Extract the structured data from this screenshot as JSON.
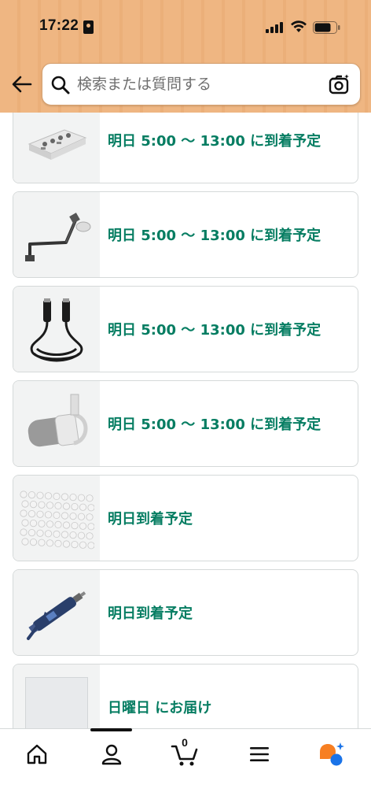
{
  "status_bar": {
    "time": "17:22"
  },
  "search": {
    "placeholder": "検索または質問する"
  },
  "orders": [
    {
      "delivery_text": "明日 5:00 〜 13:00 に到着予定",
      "item": "audio-mixer-image"
    },
    {
      "delivery_text": "明日 5:00 〜 13:00 に到着予定",
      "item": "mic-boom-arm-image"
    },
    {
      "delivery_text": "明日 5:00 〜 13:00 に到着予定",
      "item": "xlr-cable-image"
    },
    {
      "delivery_text": "明日 5:00 〜 13:00 に到着予定",
      "item": "microphone-image"
    },
    {
      "delivery_text": "明日到着予定",
      "item": "round-pads-image"
    },
    {
      "delivery_text": "明日到着予定",
      "item": "thermal-paste-image"
    },
    {
      "delivery_text": "日曜日 にお届け",
      "item": "white-panel-image"
    }
  ],
  "bottom_nav": {
    "items": [
      "home-icon",
      "account-icon",
      "cart-icon",
      "menu-icon",
      "assistant-icon"
    ],
    "cart_count": "0"
  },
  "colors": {
    "header": "#efb682",
    "delivery_green": "#067d62",
    "assistant_orange": "#f77f22",
    "assistant_blue": "#1a73e8"
  }
}
